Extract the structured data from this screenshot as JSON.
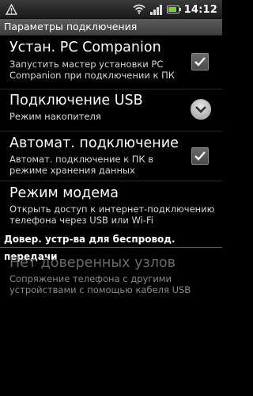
{
  "statusbar": {
    "time": "14:12",
    "left_icon": "warning-icon",
    "wifi_icon": "wifi-icon",
    "signal_icon": "signal-bars-icon",
    "battery_icon": "battery-icon",
    "battery_level": 0.85
  },
  "titlebar": {
    "title": "Параметры подключения"
  },
  "settings": [
    {
      "title": "Устан. PC Companion",
      "summary": "Запустить мастер установки PC Companion при подключении к ПК",
      "control": "checkbox",
      "checked": true
    },
    {
      "title": "Подключение USB",
      "summary": "Режим накопителя",
      "control": "dropdown"
    },
    {
      "title": "Автомат. подключение",
      "summary": "Автомат. подключение к ПК в режиме хранения данных",
      "control": "checkbox",
      "checked": true
    },
    {
      "title": "Режим модема",
      "summary": "Открыть доступ к интернет-подключению телефона через USB или Wi-Fi"
    }
  ],
  "section_header": "Довер. устр-ва для беспровод. передачи",
  "trusted": {
    "title": "Нет доверенных узлов",
    "summary": "Сопряжение телефона с другими устройствами с помощью кабеля USB"
  },
  "colors": {
    "background": "#000000",
    "checkmark": "#ffffff",
    "battery_fill": "#7fd12a"
  }
}
